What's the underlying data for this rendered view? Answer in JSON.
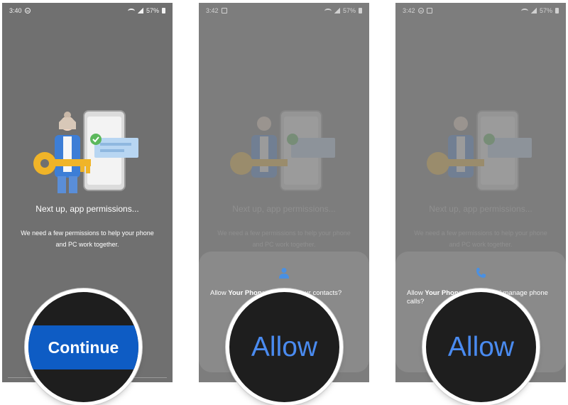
{
  "screens": [
    {
      "status": {
        "time": "3:40",
        "battery": "57%"
      },
      "heading": "Next up, app permissions...",
      "subtext_line1": "We need a few permissions to help your phone",
      "subtext_line2": "and PC work together.",
      "zoom_label": "Continue"
    },
    {
      "status": {
        "time": "3:42",
        "battery": "57%"
      },
      "heading": "Next up, app permissions...",
      "subtext_line1": "We need a few permissions to help your phone",
      "subtext_line2": "and PC work together.",
      "dialog": {
        "icon": "person-icon",
        "text_prefix": "Allow ",
        "app_name": "Your Phone",
        "text_suffix": " to access your contacts?"
      },
      "zoom_label": "Allow"
    },
    {
      "status": {
        "time": "3:42",
        "battery": "57%"
      },
      "heading": "Next up, app permissions...",
      "subtext_line1": "We need a few permissions to help your phone",
      "subtext_line2": "and PC work together.",
      "dialog": {
        "icon": "phone-icon",
        "text_prefix": "Allow ",
        "app_name": "Your Phone",
        "text_suffix": " to make and manage phone calls?"
      },
      "zoom_label": "Allow"
    }
  ],
  "colors": {
    "screen_bg": "#707070",
    "continue_blue": "#0e5cc4",
    "allow_blue": "#4a8bf0",
    "dialog_icon": "#4a90e2"
  }
}
